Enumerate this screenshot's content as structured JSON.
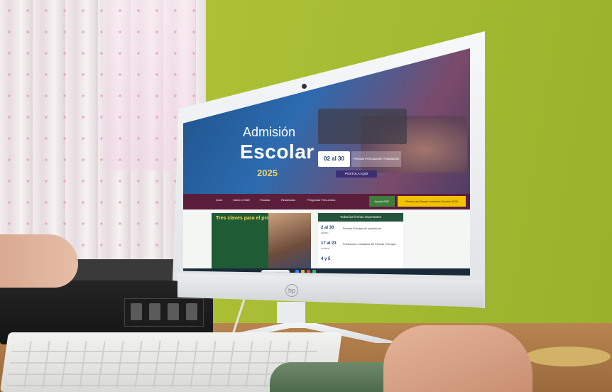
{
  "site": {
    "brand_line1": "Admisión",
    "brand_line2": "Escolar",
    "brand_year": "2025",
    "notice_text": "",
    "date_value": "02 al 30",
    "date_label": "Periodo Principal de Postulación",
    "cta_label": "POSTULA AQUÍ"
  },
  "nav": {
    "items": [
      "Inicio",
      "Sobre el SAE",
      "Postular",
      "Resultados",
      "Preguntas Frecuentes"
    ],
    "button_label": "Ayuda SAE",
    "highlight_label": "Revisa las Etapas Admisión Escolar 2025"
  },
  "content": {
    "card_title": "Tres claves para el proceso",
    "card_lines": [
      "",
      "",
      ""
    ],
    "dates_header": "Todas las fechas importantes",
    "dates": [
      {
        "date": "2 al 30",
        "sub": "agosto",
        "text": "Periodo Principal de postulación"
      },
      {
        "date": "17 al 23",
        "sub": "octubre",
        "text": "Publicación resultados del Periodo Principal"
      },
      {
        "date": "4 y 5",
        "sub": "",
        "text": ""
      }
    ]
  },
  "taskbar": {
    "time": "",
    "date": ""
  },
  "monitor": {
    "brand_logo": "hp"
  }
}
